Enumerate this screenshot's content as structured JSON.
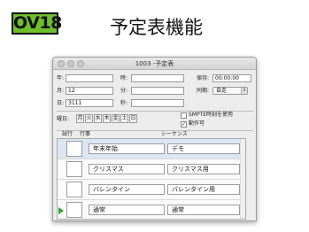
{
  "slide": {
    "badge": "OV18",
    "title": "予定表機能",
    "badge_color": "#6fbf2c"
  },
  "window": {
    "title": "1003 -予定表",
    "controls": [
      "close-icon",
      "minimize-icon",
      "zoom-icon"
    ]
  },
  "form": {
    "year_label": "年:",
    "year_value": "",
    "month_label": "月:",
    "month_value": "12",
    "day_label": "日:",
    "day_value": "3111",
    "hour_label": "時:",
    "hour_value": "",
    "minute_label": "分:",
    "minute_value": "",
    "second_label": "秒:",
    "second_value": "",
    "hold_label": "保持:",
    "hold_value": "00:00:00",
    "sync_label": "同期:",
    "sync_value": "自走",
    "weekday_label": "曜日:",
    "weekdays": [
      "月",
      "火",
      "水",
      "木",
      "金",
      "土",
      "日"
    ],
    "smpte_label": "SMPTE時刻を使用",
    "smpte_checked": false,
    "enabled_label": "動作可",
    "enabled_checked": true
  },
  "table": {
    "headers": {
      "trial": "試行",
      "event": "行事",
      "sequence": "シーケンス"
    },
    "rows": [
      {
        "event": "年末年始",
        "sequence": "デモ",
        "selected": true,
        "playing": false
      },
      {
        "event": "クリスマス",
        "sequence": "クリスマス用",
        "selected": false,
        "playing": false
      },
      {
        "event": "バレンタイン",
        "sequence": "バレンタイン用",
        "selected": false,
        "playing": false
      },
      {
        "event": "通常",
        "sequence": "通常",
        "selected": false,
        "playing": true
      }
    ]
  }
}
